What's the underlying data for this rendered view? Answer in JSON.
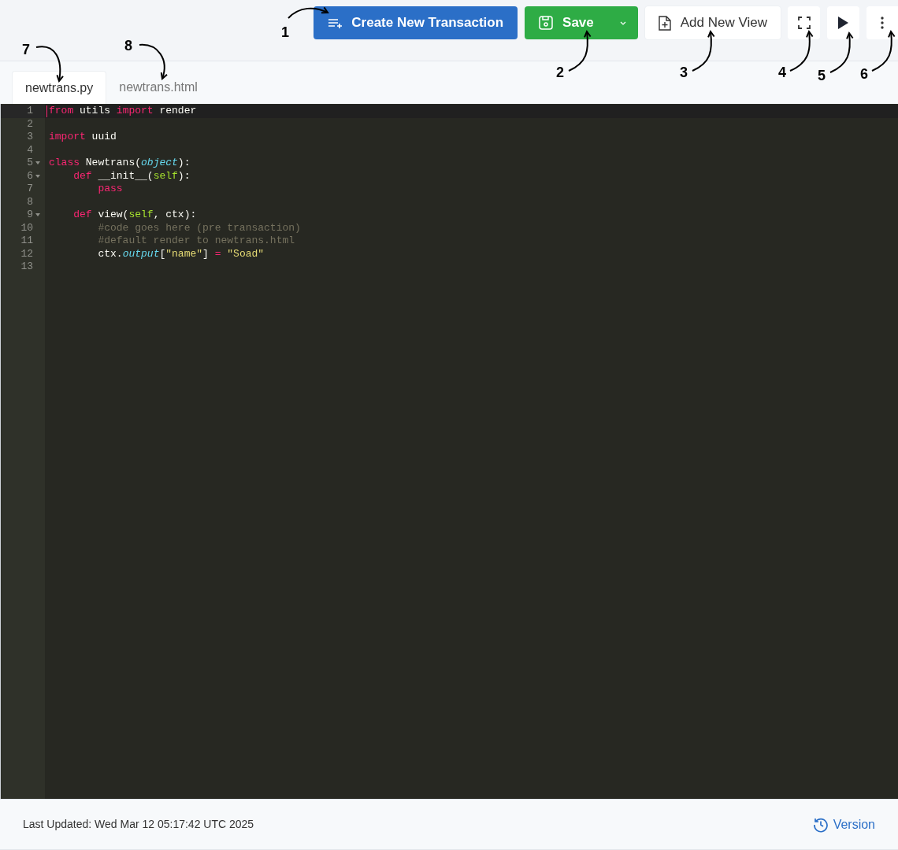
{
  "toolbar": {
    "buttons": [
      {
        "kind": "primary",
        "label": "Create New Transaction"
      },
      {
        "kind": "split",
        "label": "Save"
      },
      {
        "kind": "outline",
        "label": "Add New View"
      },
      {
        "kind": "fullscreen"
      },
      {
        "kind": "run"
      },
      {
        "kind": "more"
      }
    ]
  },
  "tabs": [
    {
      "label": "newtrans.py",
      "selected": true
    },
    {
      "label": "newtrans.html",
      "selected": false
    }
  ],
  "code_lines": [
    {
      "number": "1",
      "fold": false,
      "active": true,
      "tokens": [
        {
          "kind": "keyword",
          "text": "from"
        },
        {
          "kind": "plain",
          "text": " utils "
        },
        {
          "kind": "keyword",
          "text": "import"
        },
        {
          "kind": "plain",
          "text": " render"
        }
      ]
    },
    {
      "number": "2",
      "fold": false,
      "active": false
    },
    {
      "number": "3",
      "fold": false,
      "active": false,
      "tokens": [
        {
          "kind": "keyword",
          "text": "import"
        },
        {
          "kind": "plain",
          "text": " uuid"
        }
      ]
    },
    {
      "number": "4",
      "fold": false,
      "active": false
    },
    {
      "number": "5",
      "fold": true,
      "active": false,
      "tokens": [
        {
          "kind": "keyword",
          "text": "class"
        },
        {
          "kind": "plain",
          "text": " Newtrans("
        },
        {
          "kind": "builtin",
          "text": "object"
        },
        {
          "kind": "plain",
          "text": "):"
        }
      ]
    },
    {
      "number": "6",
      "fold": true,
      "active": false,
      "tokens": [
        {
          "kind": "keyword",
          "text": "    def"
        },
        {
          "kind": "plain",
          "text": " __init__("
        },
        {
          "kind": "param",
          "text": "self"
        },
        {
          "kind": "plain",
          "text": "):"
        }
      ]
    },
    {
      "number": "7",
      "fold": false,
      "active": false,
      "tokens": [
        {
          "kind": "keyword",
          "text": "        pass"
        }
      ]
    },
    {
      "number": "8",
      "fold": false,
      "active": false
    },
    {
      "number": "9",
      "fold": true,
      "active": false,
      "tokens": [
        {
          "kind": "keyword",
          "text": "    def"
        },
        {
          "kind": "plain",
          "text": " view("
        },
        {
          "kind": "param",
          "text": "self"
        },
        {
          "kind": "plain",
          "text": ", ctx):"
        }
      ]
    },
    {
      "number": "10",
      "fold": false,
      "active": false,
      "tokens": [
        {
          "kind": "comment",
          "text": "        #code goes here (pre transaction)"
        }
      ]
    },
    {
      "number": "11",
      "fold": false,
      "active": false,
      "tokens": [
        {
          "kind": "comment",
          "text": "        #default render to newtrans.html"
        }
      ]
    },
    {
      "number": "12",
      "fold": false,
      "active": false,
      "tokens": [
        {
          "kind": "plain",
          "text": "        ctx."
        },
        {
          "kind": "builtin",
          "text": "output"
        },
        {
          "kind": "plain",
          "text": "["
        },
        {
          "kind": "string",
          "text": "\"name\""
        },
        {
          "kind": "plain",
          "text": "] "
        },
        {
          "kind": "keyword",
          "text": "="
        },
        {
          "kind": "string",
          "text": " \"Soad\""
        }
      ]
    },
    {
      "number": "13",
      "fold": false,
      "active": false
    }
  ],
  "footer": {
    "last_updated": "Last Updated: Wed Mar 12 05:17:42 UTC 2025",
    "version_link": "Version"
  },
  "annotations": [
    {
      "label": "1"
    },
    {
      "label": "2"
    },
    {
      "label": "3"
    },
    {
      "label": "4"
    },
    {
      "label": "5"
    },
    {
      "label": "6"
    },
    {
      "label": "7"
    },
    {
      "label": "8"
    }
  ]
}
